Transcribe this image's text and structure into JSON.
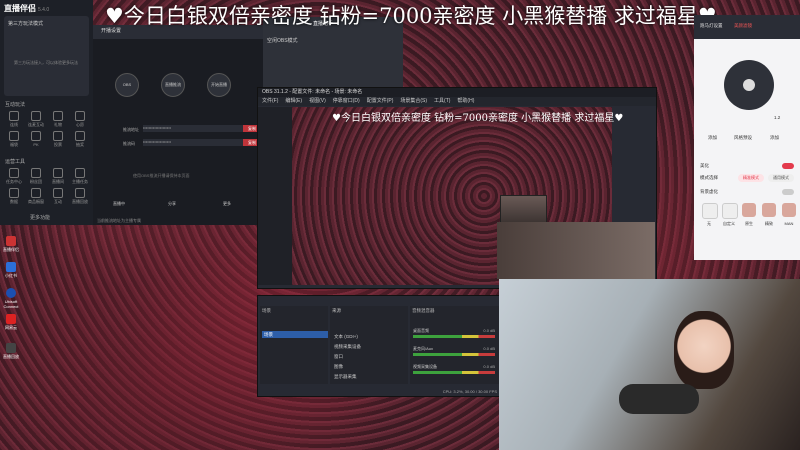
{
  "marquee": "♥今日白银双倍亲密度 钻粉=7000亲密度 小黑猴替播 求过福星♥",
  "obs_marquee": "♥今日白银双倍亲密度 钻粉=7000亲密度 小黑猴替播 求过福星♥",
  "left_app": {
    "logo": "直播伴侣",
    "version": "5.4.0",
    "panel_title": "第三方玩法模式",
    "panel_hint": "第三方玩法接入，可以体验更多玩法",
    "section_tools": "互动玩法",
    "section_apps": "运营工具",
    "tools": [
      "连线",
      "连麦互动",
      "礼物",
      "心愿",
      "福袋",
      "PK",
      "投票",
      "抽奖"
    ],
    "apps": [
      "任务中心",
      "粉丝团",
      "直播间",
      "主播任务",
      "数据",
      "商品橱窗",
      "互动",
      "直播回放"
    ],
    "more": "更多功能",
    "bottom_note": "当前推流地址为主播专属"
  },
  "studio": {
    "tab": "开播设置",
    "steps": [
      "OBS",
      "直播推流",
      "开始直播",
      "设置"
    ],
    "url_label": "推流地址",
    "key_label": "推流码",
    "copy": "复制",
    "note": "使用OBS推流开播请保持本页面",
    "bottom_items": [
      "直播中",
      "分享",
      "更多"
    ]
  },
  "midpanel": {
    "title": "直播助手",
    "select": "空闲OBS模式"
  },
  "obs": {
    "title": "OBS 31.1.2 - 配置文件: 未命名 - 场景: 未命名",
    "menu": [
      "文件(F)",
      "编辑(E)",
      "视图(V)",
      "停靠窗口(D)",
      "配置文件(P)",
      "场景集合(S)",
      "工具(T)",
      "帮助(H)"
    ],
    "docks": {
      "scenes_title": "场景",
      "sources_title": "来源",
      "mixer_title": "音频混音器",
      "scene_item": "场景",
      "sources": [
        "文本 (GDI+)",
        "视频采集设备",
        "窗口",
        "图像",
        "显示器采集"
      ],
      "mixer": [
        {
          "name": "桌面音频",
          "db": "0.0 dB"
        },
        {
          "name": "麦克风/Aux",
          "db": "0.0 dB"
        },
        {
          "name": "视频采集设备",
          "db": "0.0 dB"
        }
      ],
      "status": "CPU: 3.2%, 30.00 / 30.00 FPS"
    }
  },
  "beauty": {
    "top": "跑马灯设置",
    "top_red": "美颜滤镜",
    "add": "添加",
    "preset": "风格预设",
    "add2": "添加",
    "sec_beauty": "美化",
    "mode_label": "模式选择",
    "mode_a": "精准模式",
    "mode_b": "通用模式",
    "sec_bg": "背景虚化",
    "sec_filter": "美颜",
    "faces": [
      "无",
      "自定义",
      "原生",
      "精致",
      "MAN"
    ],
    "value": "1.2"
  },
  "desktop_icons": [
    "直播伴侣",
    "小红书",
    "Ubisoft Connect",
    "网易云",
    "直播回放"
  ],
  "colors": {
    "accent": "#e33a4c",
    "obs_scene": "#2d5ea8"
  }
}
